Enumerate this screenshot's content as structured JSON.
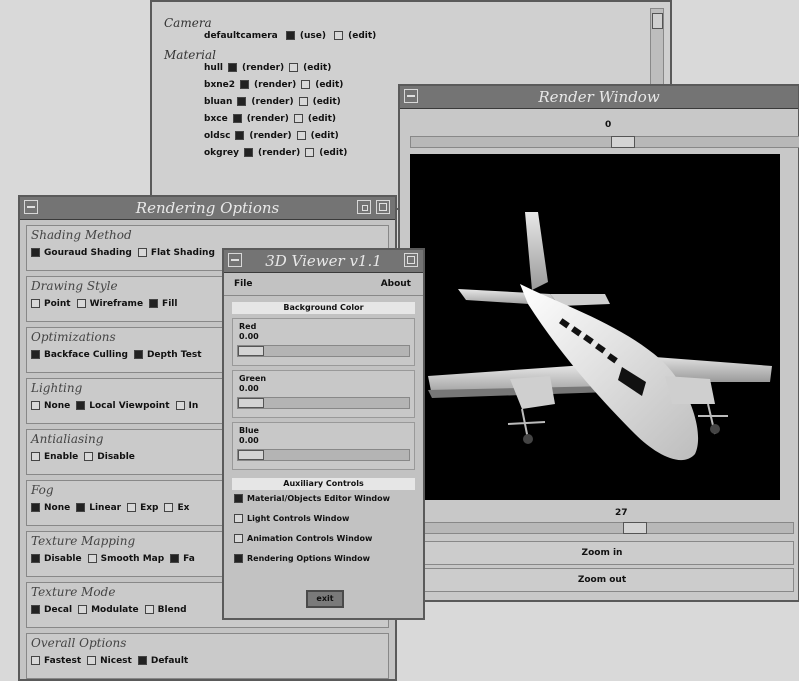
{
  "material_window": {
    "camera_header": "Camera",
    "camera_row": {
      "name": "defaultcamera",
      "left": "(use)",
      "right": "(edit)"
    },
    "material_header": "Material",
    "rows": [
      {
        "name": "hull",
        "left": "(render)",
        "right": "(edit)"
      },
      {
        "name": "bxne2",
        "left": "(render)",
        "right": "(edit)"
      },
      {
        "name": "bluan",
        "left": "(render)",
        "right": "(edit)"
      },
      {
        "name": "bxce",
        "left": "(render)",
        "right": "(edit)"
      },
      {
        "name": "oldsc",
        "left": "(render)",
        "right": "(edit)"
      },
      {
        "name": "okgrey",
        "left": "(render)",
        "right": "(edit)"
      }
    ]
  },
  "render_window": {
    "title": "Render Window",
    "top_value": "0",
    "bottom_value": "27",
    "zoom_in_label": "Zoom in",
    "zoom_out_label": "Zoom out"
  },
  "rendering_options": {
    "title": "Rendering Options",
    "sections": [
      {
        "title": "Shading Method",
        "options": [
          {
            "label": "Gouraud Shading",
            "checked": true
          },
          {
            "label": "Flat Shading",
            "checked": false
          }
        ]
      },
      {
        "title": "Drawing Style",
        "options": [
          {
            "label": "Point",
            "checked": false
          },
          {
            "label": "Wireframe",
            "checked": false
          },
          {
            "label": "Fill",
            "checked": true
          }
        ]
      },
      {
        "title": "Optimizations",
        "options": [
          {
            "label": "Backface Culling",
            "checked": true
          },
          {
            "label": "Depth Test",
            "checked": true
          }
        ]
      },
      {
        "title": "Lighting",
        "options": [
          {
            "label": "None",
            "checked": false
          },
          {
            "label": "Local Viewpoint",
            "checked": true
          },
          {
            "label": "In",
            "checked": false
          }
        ]
      },
      {
        "title": "Antialiasing",
        "options": [
          {
            "label": "Enable",
            "checked": false
          },
          {
            "label": "Disable",
            "checked": false
          }
        ]
      },
      {
        "title": "Fog",
        "options": [
          {
            "label": "None",
            "checked": true
          },
          {
            "label": "Linear",
            "checked": true
          },
          {
            "label": "Exp",
            "checked": false
          },
          {
            "label": "Ex",
            "checked": false
          }
        ]
      },
      {
        "title": "Texture Mapping",
        "options": [
          {
            "label": "Disable",
            "checked": true
          },
          {
            "label": "Smooth Map",
            "checked": false
          },
          {
            "label": "Fa",
            "checked": true
          }
        ]
      },
      {
        "title": "Texture Mode",
        "options": [
          {
            "label": "Decal",
            "checked": true
          },
          {
            "label": "Modulate",
            "checked": false
          },
          {
            "label": "Blend",
            "checked": false
          }
        ]
      },
      {
        "title": "Overall Options",
        "options": [
          {
            "label": "Fastest",
            "checked": false
          },
          {
            "label": "Nicest",
            "checked": false
          },
          {
            "label": "Default",
            "checked": true
          }
        ]
      }
    ]
  },
  "viewer": {
    "title": "3D Viewer v1.1",
    "menu_file": "File",
    "menu_about": "About",
    "bg_header": "Background Color",
    "sliders": [
      {
        "name": "Red",
        "value": "0.00"
      },
      {
        "name": "Green",
        "value": "0.00"
      },
      {
        "name": "Blue",
        "value": "0.00"
      }
    ],
    "aux_header": "Auxiliary Controls",
    "aux": [
      {
        "label": "Material/Objects Editor Window",
        "checked": true
      },
      {
        "label": "Light Controls Window",
        "checked": false
      },
      {
        "label": "Animation Controls Window",
        "checked": false
      },
      {
        "label": "Rendering Options Window",
        "checked": true
      }
    ],
    "exit_label": "exit"
  },
  "colors": {
    "title_bar": "#747474",
    "window_bg": "#c4c4c4",
    "canvas_bg": "#000000",
    "plane_body": "#f2f2f2"
  }
}
